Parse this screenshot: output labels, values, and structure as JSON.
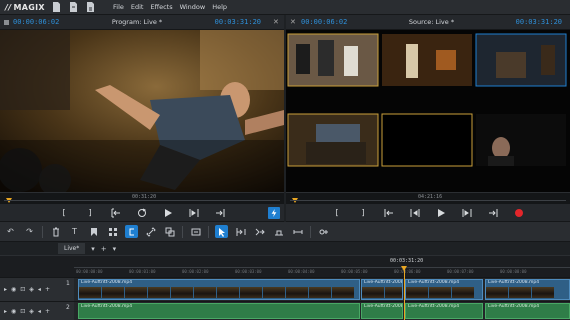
{
  "app": {
    "logo": "MAGIX",
    "menu": [
      "File",
      "Edit",
      "Effects",
      "Window",
      "Help"
    ]
  },
  "program_monitor": {
    "timecode_left": "00:00:06:02",
    "title": "Program: Live *",
    "timecode_right": "00:03:31:20",
    "ruler_time": "00:31:20"
  },
  "source_monitor": {
    "timecode_left": "00:00:06:02",
    "title": "Source: Live *",
    "timecode_right": "00:03:31:20",
    "ruler_time": "04:21:16"
  },
  "timeline": {
    "tab_label": "Live*",
    "position_label": "00:03:31:20",
    "ticks": [
      "00:00:00:00",
      "00:00:01:00",
      "00:00:02:00",
      "00:00:03:00",
      "00:00:04:00",
      "00:00:05:00",
      "00:00:06:00",
      "00:00:07:00",
      "00:00:08:00",
      "00:00:09:00"
    ],
    "tracks": [
      {
        "number": "1",
        "clips": [
          "Live-Auftritt-2008.mp4",
          "Live-Auftritt-2008.mp4",
          "Live-Auftritt-2008.mp4",
          "Live-Auftritt-2008.mp4"
        ]
      },
      {
        "number": "2",
        "clips": [
          "Live-Auftritt-2008.mp4",
          "Live-Auftritt-2008.mp4",
          "Live-Auftritt-2008.mp4",
          "Live-Auftritt-2008.mp4"
        ]
      }
    ]
  },
  "colors": {
    "accent": "#1f7fd0",
    "timecode": "#2e8fd8",
    "playhead": "#e8a623",
    "record": "#e3262b",
    "video_clip": "#2f5f86",
    "audio_clip": "#2f7d48"
  }
}
